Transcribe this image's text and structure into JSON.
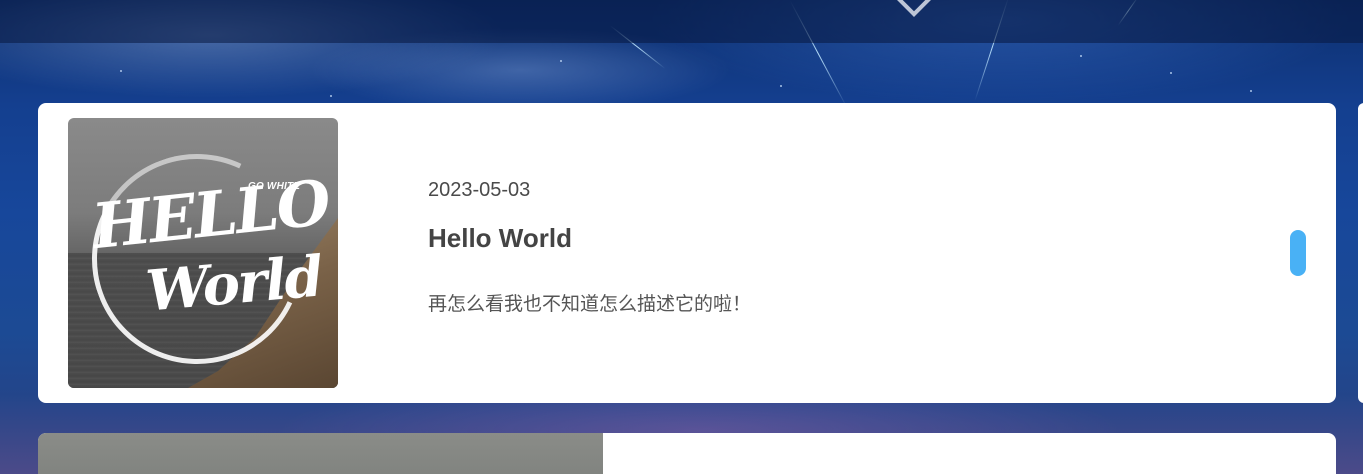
{
  "post": {
    "date": "2023-05-03",
    "title": "Hello World",
    "excerpt": "再怎么看我也不知道怎么描述它的啦！",
    "cover": {
      "tag": "GO WHITE",
      "title_line1": "HELLO",
      "title_line2": "World"
    }
  },
  "theme": {
    "accent": "#49b1f5",
    "card_bg": "#ffffff",
    "text_primary": "#444444"
  }
}
